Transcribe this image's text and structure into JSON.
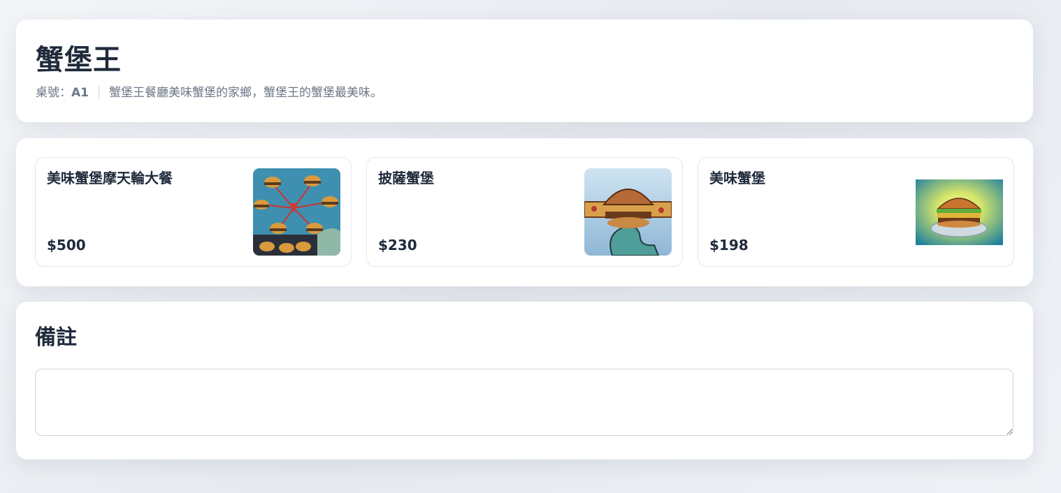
{
  "header": {
    "title": "蟹堡王",
    "table_label": "桌號：",
    "table_number": "A1",
    "description": "蟹堡王餐廳美味蟹堡的家鄉，蟹堡王的蟹堡最美味。"
  },
  "menu": {
    "items": [
      {
        "name": "美味蟹堡摩天輪大餐",
        "price": "$500",
        "image": "krabby-patty-ferris-wheel-image"
      },
      {
        "name": "披薩蟹堡",
        "price": "$230",
        "image": "pizza-krabby-patty-image"
      },
      {
        "name": "美味蟹堡",
        "price": "$198",
        "image": "krabby-patty-image"
      }
    ]
  },
  "notes": {
    "title": "備註",
    "value": "",
    "placeholder": ""
  },
  "colors": {
    "text": "#1f2a3b",
    "muted": "#6b7686",
    "card_border": "#e3e7ec",
    "background": "#eef1f5"
  }
}
